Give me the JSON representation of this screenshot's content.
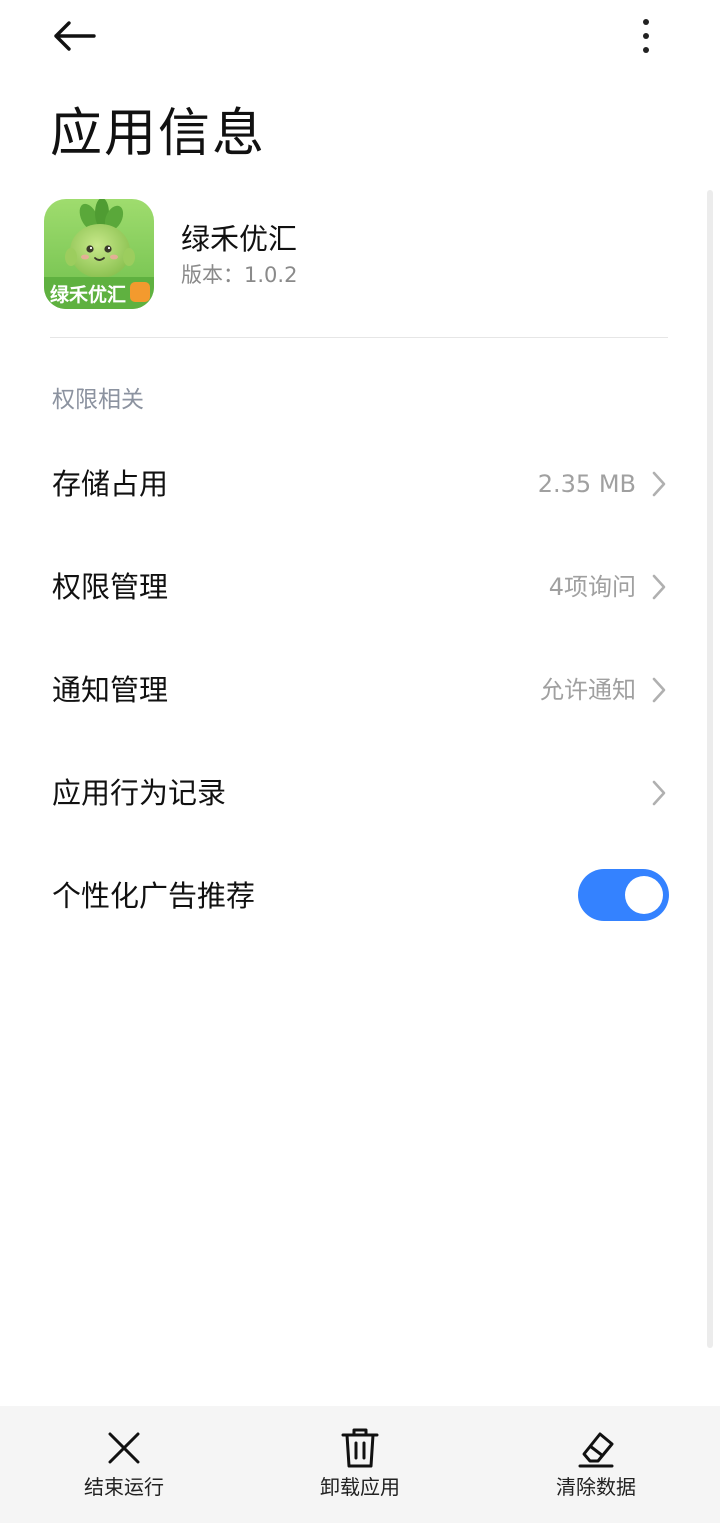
{
  "header": {
    "title": "应用信息",
    "back_icon": "back-arrow-icon",
    "more_icon": "more-vertical-icon"
  },
  "app": {
    "name": "绿禾优汇",
    "version": "版本：1.0.2",
    "icon_label": "绿禾优汇",
    "icon_colors": {
      "background": "#7fc956",
      "banner": "#6ab845",
      "mascot": "#a6d468"
    }
  },
  "section": {
    "label": "权限相关"
  },
  "rows": [
    {
      "label": "存储占用",
      "value": "2.35 MB",
      "icon": "chevron-right-icon"
    },
    {
      "label": "权限管理",
      "value": "4项询问",
      "icon": "chevron-right-icon"
    },
    {
      "label": "通知管理",
      "value": "允许通知",
      "icon": "chevron-right-icon"
    },
    {
      "label": "应用行为记录",
      "value": "",
      "icon": "chevron-right-icon"
    }
  ],
  "ad_toggle": {
    "label": "个性化广告推荐",
    "state": "on",
    "color": "#3482ff"
  },
  "bottom_actions": [
    {
      "label": "结束运行",
      "icon": "close-icon"
    },
    {
      "label": "卸载应用",
      "icon": "trash-icon"
    },
    {
      "label": "清除数据",
      "icon": "eraser-icon"
    }
  ]
}
